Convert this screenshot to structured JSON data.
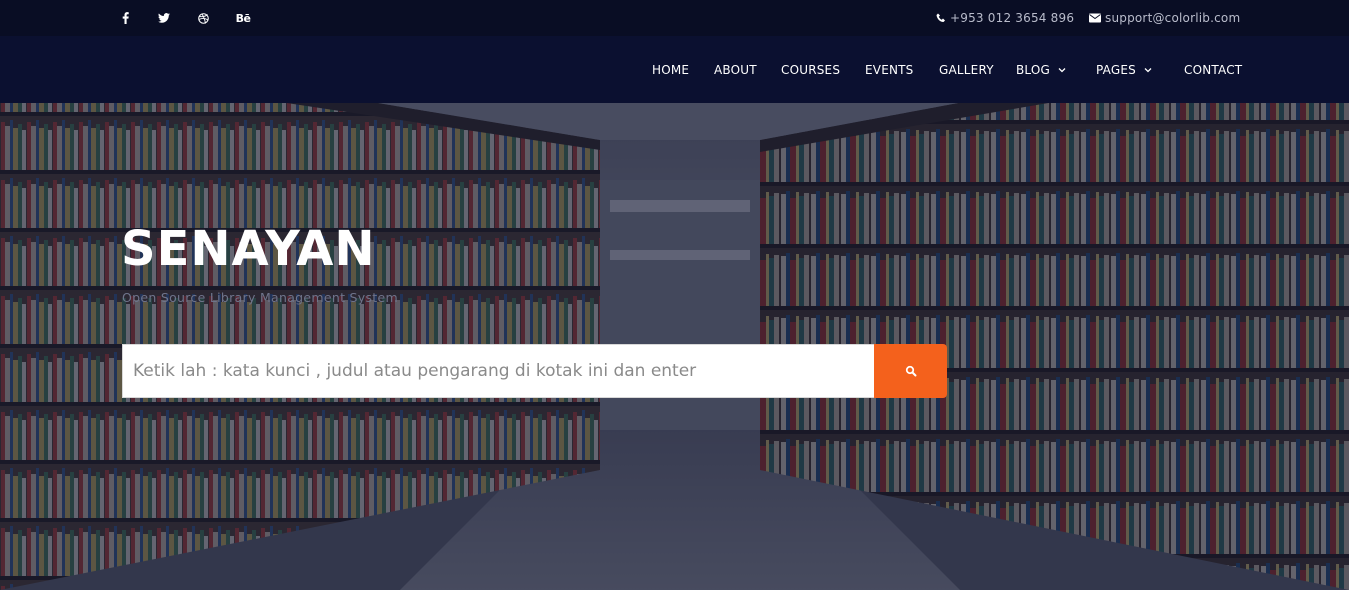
{
  "topbar": {
    "social": [
      {
        "icon": "facebook-icon",
        "glyph": "f"
      },
      {
        "icon": "twitter-icon",
        "glyph": "twitter"
      },
      {
        "icon": "dribbble-icon",
        "glyph": "dribbble"
      },
      {
        "icon": "behance-icon",
        "glyph": "Bē"
      }
    ],
    "phone": "+953 012 3654 896",
    "email": "support@colorlib.com"
  },
  "nav": {
    "items": [
      {
        "label": "HOME",
        "dropdown": false
      },
      {
        "label": "ABOUT",
        "dropdown": false
      },
      {
        "label": "COURSES",
        "dropdown": false
      },
      {
        "label": "EVENTS",
        "dropdown": false
      },
      {
        "label": "GALLERY",
        "dropdown": false
      },
      {
        "label": "BLOG",
        "dropdown": true
      },
      {
        "label": "PAGES",
        "dropdown": true
      },
      {
        "label": "CONTACT",
        "dropdown": false
      }
    ]
  },
  "hero": {
    "title": "SENAYAN",
    "subtitle": "Open Source Library Management System",
    "search_placeholder": "Ketik lah : kata kunci , judul atau pengarang di kotak ini dan enter",
    "search_value": ""
  },
  "colors": {
    "accent": "#f4611c",
    "topbar_bg": "#090d24",
    "navbar_bg": "#0b1030",
    "hero_overlay": "#0e122c"
  }
}
